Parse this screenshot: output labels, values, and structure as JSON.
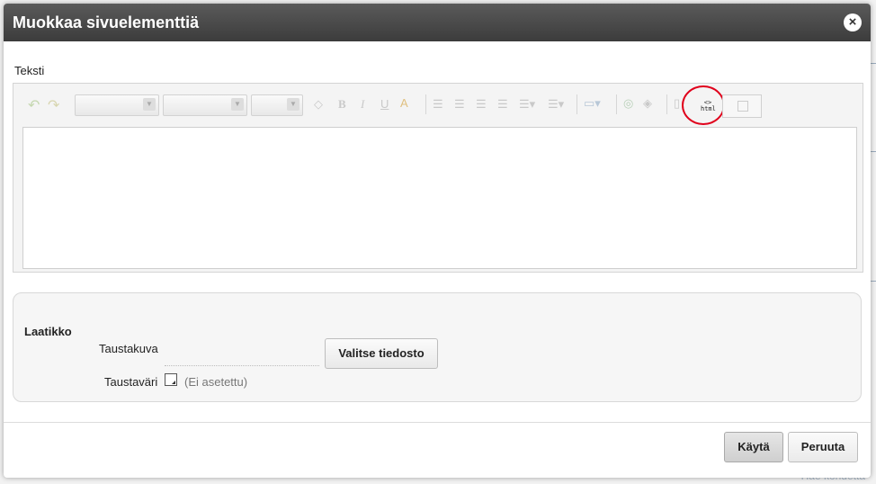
{
  "dialog": {
    "title": "Muokkaa sivuelementtiä",
    "close_label": "×"
  },
  "editor": {
    "section_label": "Teksti",
    "html_button_label": "<>\nhtml",
    "content": ""
  },
  "box": {
    "title": "Laatikko",
    "background_image_label": "Taustakuva",
    "choose_file_label": "Valitse tiedosto",
    "background_color_label": "Taustaväri",
    "not_set_text": "(Ei asetettu)"
  },
  "footer": {
    "apply_label": "Käytä",
    "cancel_label": "Peruuta"
  },
  "background_page": {
    "bottom_link": "Hae kohdetta"
  },
  "colors": {
    "titlebar": "#4a4a4a",
    "highlight_circle": "#e0001b"
  }
}
